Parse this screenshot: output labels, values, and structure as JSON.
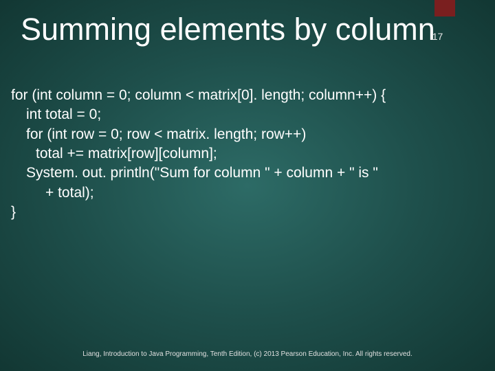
{
  "slide": {
    "title": "Summing elements by column",
    "page_number": "17",
    "code": {
      "l1": "for (int column = 0; column < matrix[0]. length; column++) {",
      "l2": "int total = 0;",
      "l3": "for (int row = 0; row < matrix. length; row++)",
      "l4": "total += matrix[row][column];",
      "l5": "System. out. println(\"Sum for column \" + column + \" is \"",
      "l6": "+ total);",
      "l7": "}"
    },
    "footer": "Liang, Introduction to Java Programming, Tenth Edition, (c) 2013 Pearson Education, Inc. All rights reserved."
  }
}
